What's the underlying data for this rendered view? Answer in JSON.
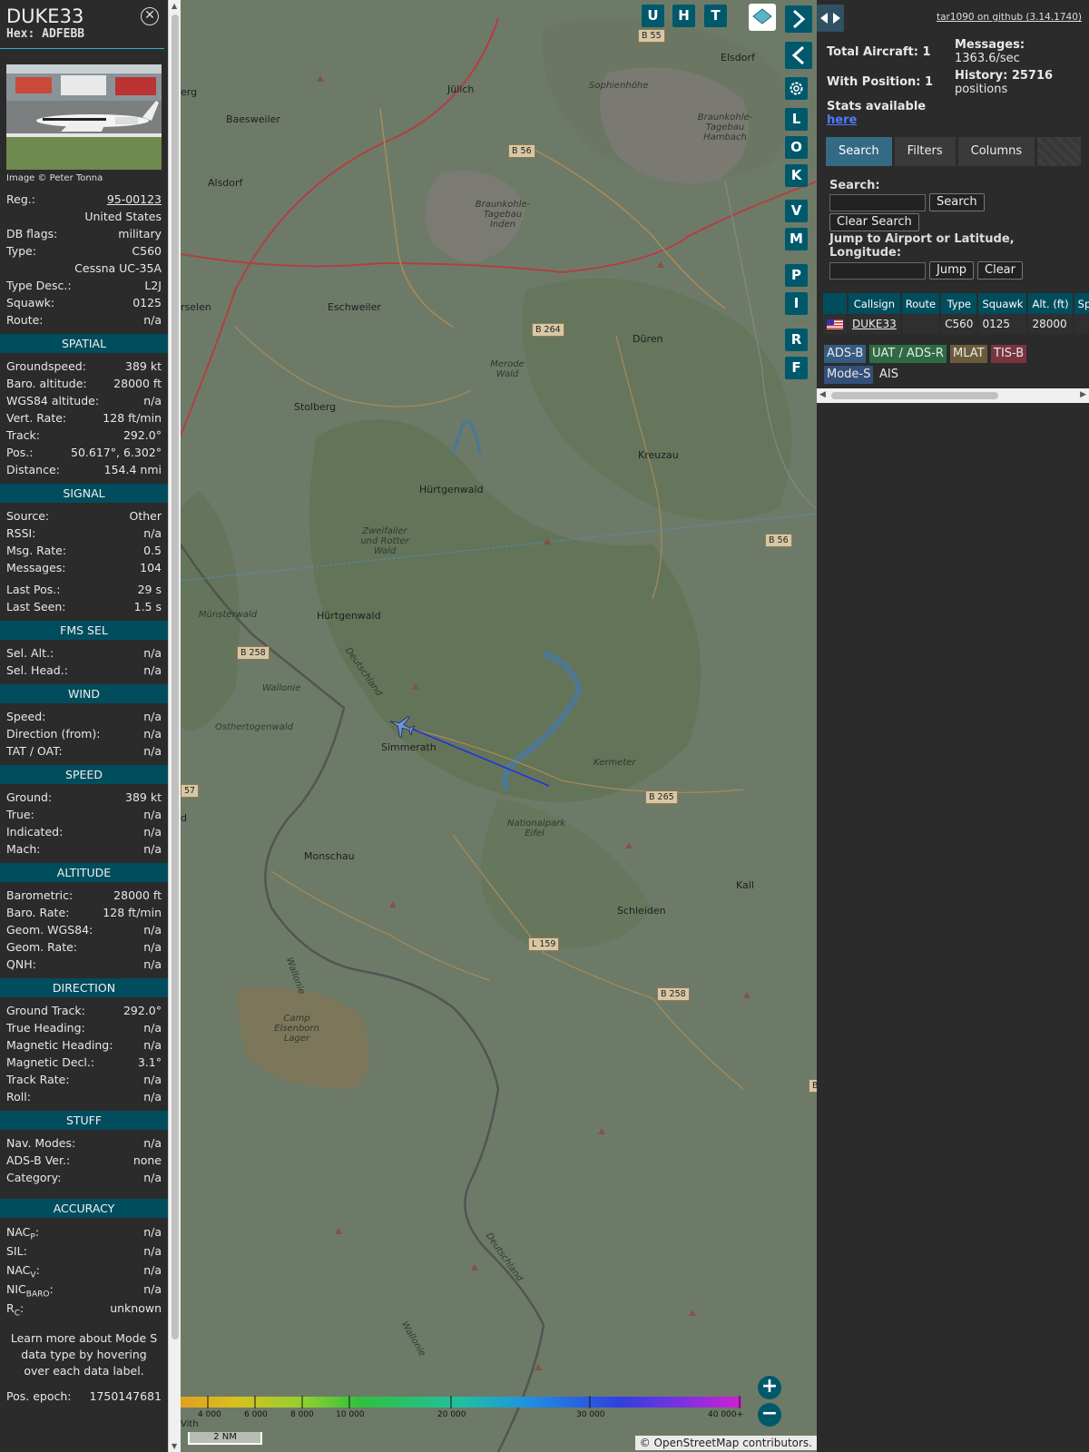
{
  "infoblock": {
    "callsign": "DUKE33",
    "hex_label": "Hex: ADFEBB",
    "image_credit": "Image © Peter Tonna",
    "general": [
      {
        "k": "Reg.:",
        "v": "95-00123",
        "link": true
      },
      {
        "k": "",
        "v": "United States"
      },
      {
        "k": "DB flags:",
        "v": "military"
      },
      {
        "k": "Type:",
        "v": "C560"
      },
      {
        "k": "",
        "v": "Cessna UC-35A"
      },
      {
        "k": "Type Desc.:",
        "v": "L2J"
      },
      {
        "k": "Squawk:",
        "v": "0125"
      },
      {
        "k": "Route:",
        "v": "n/a"
      }
    ],
    "sections": [
      {
        "title": "SPATIAL",
        "rows": [
          {
            "k": "Groundspeed:",
            "v": "389 kt"
          },
          {
            "k": "Baro. altitude:",
            "v": "28000 ft"
          },
          {
            "k": "WGS84 altitude:",
            "v": "n/a"
          },
          {
            "k": "Vert. Rate:",
            "v": "128 ft/min"
          },
          {
            "k": "Track:",
            "v": "292.0°"
          },
          {
            "k": "Pos.:",
            "v": "50.617°, 6.302°"
          },
          {
            "k": "Distance:",
            "v": "154.4 nmi"
          }
        ]
      },
      {
        "title": "SIGNAL",
        "rows": [
          {
            "k": "Source:",
            "v": "Other"
          },
          {
            "k": "RSSI:",
            "v": "n/a"
          },
          {
            "k": "Msg. Rate:",
            "v": "0.5"
          },
          {
            "k": "Messages:",
            "v": "104"
          },
          {
            "k": "Last Pos.:",
            "v": "29 s"
          },
          {
            "k": "Last Seen:",
            "v": "1.5 s"
          }
        ]
      },
      {
        "title": "FMS SEL",
        "rows": [
          {
            "k": "Sel. Alt.:",
            "v": "n/a"
          },
          {
            "k": "Sel. Head.:",
            "v": "n/a"
          }
        ]
      },
      {
        "title": "WIND",
        "rows": [
          {
            "k": "Speed:",
            "v": "n/a"
          },
          {
            "k": "Direction (from):",
            "v": "n/a"
          },
          {
            "k": "TAT / OAT:",
            "v": "n/a"
          }
        ]
      },
      {
        "title": "SPEED",
        "rows": [
          {
            "k": "Ground:",
            "v": "389 kt"
          },
          {
            "k": "True:",
            "v": "n/a"
          },
          {
            "k": "Indicated:",
            "v": "n/a"
          },
          {
            "k": "Mach:",
            "v": "n/a"
          }
        ]
      },
      {
        "title": "ALTITUDE",
        "rows": [
          {
            "k": "Barometric:",
            "v": "28000 ft"
          },
          {
            "k": "Baro. Rate:",
            "v": "128 ft/min"
          },
          {
            "k": "Geom. WGS84:",
            "v": "n/a"
          },
          {
            "k": "Geom. Rate:",
            "v": "n/a"
          },
          {
            "k": "QNH:",
            "v": "n/a"
          }
        ]
      },
      {
        "title": "DIRECTION",
        "rows": [
          {
            "k": "Ground Track:",
            "v": "292.0°"
          },
          {
            "k": "True Heading:",
            "v": "n/a"
          },
          {
            "k": "Magnetic Heading:",
            "v": "n/a"
          },
          {
            "k": "Magnetic Decl.:",
            "v": "3.1°"
          },
          {
            "k": "Track Rate:",
            "v": "n/a"
          },
          {
            "k": "Roll:",
            "v": "n/a"
          }
        ]
      },
      {
        "title": "STUFF",
        "rows": [
          {
            "k": "Nav. Modes:",
            "v": "n/a"
          },
          {
            "k": "ADS-B Ver.:",
            "v": "none"
          },
          {
            "k": "Category:",
            "v": "n/a"
          }
        ]
      }
    ],
    "accuracy_title": "ACCURACY",
    "accuracy": [
      {
        "k": "NAC",
        "sub": "P",
        "v": "n/a"
      },
      {
        "k": "SIL:",
        "sub": "",
        "v": "n/a"
      },
      {
        "k": "NAC",
        "sub": "V",
        "v": "n/a"
      },
      {
        "k": "NIC",
        "sub": "BARO",
        "v": "n/a"
      },
      {
        "k": "R",
        "sub": "C",
        "v": "unknown"
      }
    ],
    "note": "Learn more about Mode S data type by hovering over each data label.",
    "epoch_label": "Pos. epoch:",
    "epoch_value": "1750147681"
  },
  "map": {
    "buttons": [
      "U",
      "H",
      "T"
    ],
    "side_buttons": [
      "L",
      "O",
      "K",
      "V",
      "M",
      "P",
      "I",
      "R",
      "F"
    ],
    "places": [
      "Jülich",
      "Baesweiler",
      "Alsdorf",
      "Eschweiler",
      "Stolberg",
      "Düren",
      "Kreuzau",
      "Simmerath",
      "Monschau",
      "Schleiden",
      "Kall",
      "Elsdorf",
      "Hürtgenwald",
      "Hürtgenwald",
      "erg",
      "rselen",
      "d"
    ],
    "italic_places": [
      "Sophienhöhe",
      "Braunkohle-Tagebau Hambach",
      "Braunkohle-Tagebau Inden",
      "Merode Wald",
      "Zweifaller und Rotter Wald",
      "Münsterwald",
      "Osthertogenwald",
      "Wallonie",
      "Deutschland",
      "Kermeter",
      "Nationalpark Eifel",
      "Camp Elsenborn Lager",
      "Wallonie",
      "Deutschland",
      "Wallonie"
    ],
    "roads": [
      "B 55",
      "B 56",
      "B 264",
      "B 56",
      "B 258",
      "B 265",
      "L 159",
      "B 258",
      "57",
      "B"
    ],
    "colorbar_ticks": [
      "4 000",
      "6 000",
      "8 000",
      "10 000",
      "20 000",
      "30 000",
      "40 000+"
    ],
    "scale": "2 NM",
    "attribution": "© OpenStreetMap contributors.",
    "vith": "Vith",
    "colors": {
      "aircraft": "#6f95d6",
      "track": "#2233dd",
      "buttons": "#00586b"
    }
  },
  "sidebar": {
    "version_link": "tar1090 on github (3.14.1740)",
    "total_aircraft": "Total Aircraft: 1",
    "with_position": "With Position: 1",
    "stats_available": "Stats available",
    "here": "here",
    "messages_label": "Messages:",
    "messages_value": "1363.6/sec",
    "history_label": "History: 25716",
    "history_value": "positions",
    "tabs": [
      "Search",
      "Filters",
      "Columns"
    ],
    "search_label": "Search:",
    "search_button": "Search",
    "clear_search": "Clear Search",
    "jump_label": "Jump to Airport or Latitude, Longitude:",
    "jump_button": "Jump",
    "clear_button": "Clear",
    "table_headers": [
      "",
      "Callsign",
      "Route",
      "Type",
      "Squawk",
      "Alt. (ft)",
      "Spd."
    ],
    "table_rows": [
      {
        "callsign": "DUKE33",
        "route": "",
        "type": "C560",
        "squawk": "0125",
        "alt": "28000",
        "spd": ""
      }
    ],
    "legend": [
      {
        "label": "ADS-B",
        "bg": "#345c80"
      },
      {
        "label": "UAT / ADS-R",
        "bg": "#2e6b45"
      },
      {
        "label": "MLAT",
        "bg": "#6b5b3a"
      },
      {
        "label": "TIS-B",
        "bg": "#7a3440"
      },
      {
        "label": "Mode-S",
        "bg": "#34507a"
      },
      {
        "label": "AIS",
        "bg": "transparent"
      }
    ]
  }
}
